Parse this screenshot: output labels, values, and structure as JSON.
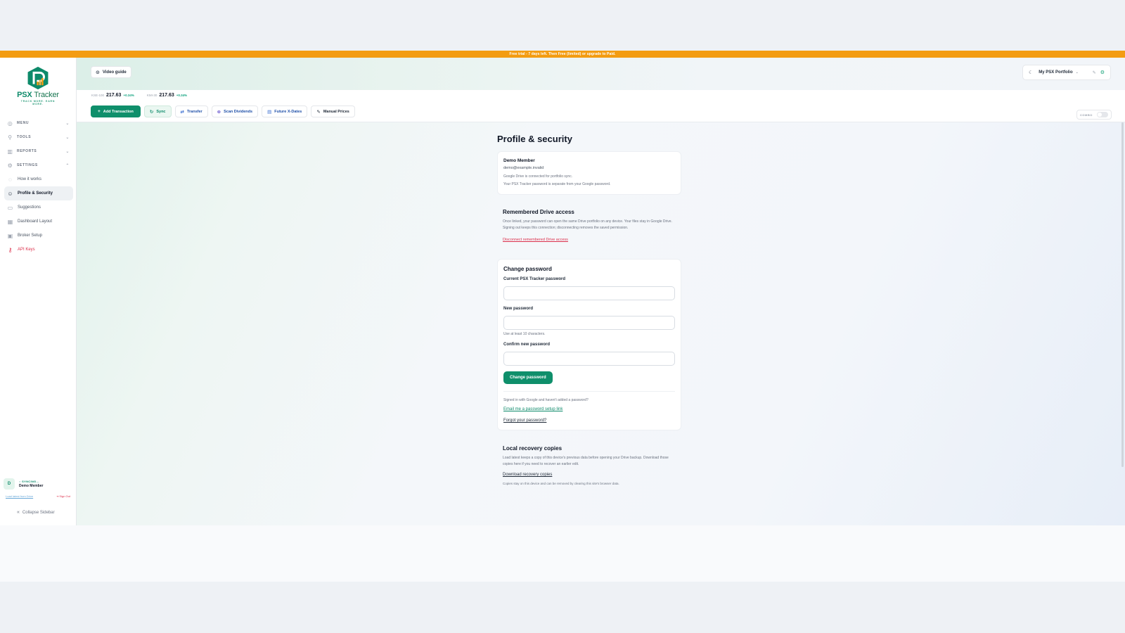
{
  "banner": {
    "text": "Free trial - 7 days left. Then Free (limited) or upgrade to Paid."
  },
  "logo": {
    "name_primary": "PSX",
    "name_secondary": "Tracker",
    "tagline": "TRACK MORE. EARN MORE."
  },
  "sidebar": {
    "sections": [
      {
        "label": "MENU",
        "icon": "compass-icon",
        "chevron": "⌄"
      },
      {
        "label": "TOOLS",
        "icon": "wrench-icon",
        "chevron": "⌄"
      },
      {
        "label": "REPORTS",
        "icon": "bar-chart-icon",
        "chevron": "⌄"
      },
      {
        "label": "SETTINGS",
        "icon": "gear-icon",
        "chevron": "⌃"
      }
    ],
    "items": [
      {
        "label": "How it works",
        "icon": "help-circle-icon"
      },
      {
        "label": "Profile & Security",
        "icon": "user-icon"
      },
      {
        "label": "Suggestions",
        "icon": "message-icon"
      },
      {
        "label": "Dashboard Layout",
        "icon": "layout-grid-icon"
      },
      {
        "label": "Broker Setup",
        "icon": "briefcase-icon"
      },
      {
        "label": "API Keys",
        "icon": "key-icon"
      }
    ],
    "user": {
      "initial": "D",
      "sync_status": "○ SYNCING...",
      "name": "Demo Member",
      "load_link": "Load latest from Drive",
      "sign_out": "Sign Out"
    },
    "collapse_label": "Collapse Sidebar"
  },
  "header": {
    "video_guide": "Video guide",
    "portfolio_name": "My PSX Portfolio",
    "combo_label": "COMBO"
  },
  "tickers": [
    {
      "name": "KSE-100",
      "value": "217.63",
      "change": "+0.34%"
    },
    {
      "name": "KMI-30",
      "value": "217.63",
      "change": "+0.34%"
    }
  ],
  "actions": {
    "add_transaction": "Add Transaction",
    "sync": "Sync",
    "transfer": "Transfer",
    "scan_dividends": "Scan Dividends",
    "future_xdates": "Future X-Dates",
    "manual_prices": "Manual Prices"
  },
  "page": {
    "title": "Profile & security",
    "profile": {
      "name": "Demo Member",
      "email": "demo@example.invalid",
      "drive_note": "Google Drive is connected for portfolio sync.",
      "password_note": "Your PSX Tracker password is separate from your Google password."
    },
    "drive_access": {
      "title": "Remembered Drive access",
      "description": "Once linked, your password can open the same Drive portfolio on any device. Your files stay in Google Drive. Signing out keeps this connection; disconnecting removes the saved permission.",
      "disconnect_link": "Disconnect remembered Drive access"
    },
    "change_password": {
      "title": "Change password",
      "current_label": "Current PSX Tracker password",
      "current_value": "",
      "new_label": "New password",
      "new_value": "",
      "new_hint": "Use at least 10 characters.",
      "confirm_label": "Confirm new password",
      "confirm_value": "",
      "submit": "Change password",
      "google_note": "Signed in with Google and haven't added a password?",
      "email_link": "Email me a password setup link",
      "forgot_link": "Forgot your password?"
    },
    "recovery": {
      "title": "Local recovery copies",
      "description": "Load latest keeps a copy of this device's previous data before opening your Drive backup. Download those copies here if you need to recover an earlier edit.",
      "download_link": "Download recovery copies",
      "note": "Copies stay on this device and can be removed by clearing this site's browser data."
    }
  },
  "colors": {
    "brand": "#0f8f6b",
    "banner": "#f39c12",
    "danger": "#dc2f4b"
  }
}
